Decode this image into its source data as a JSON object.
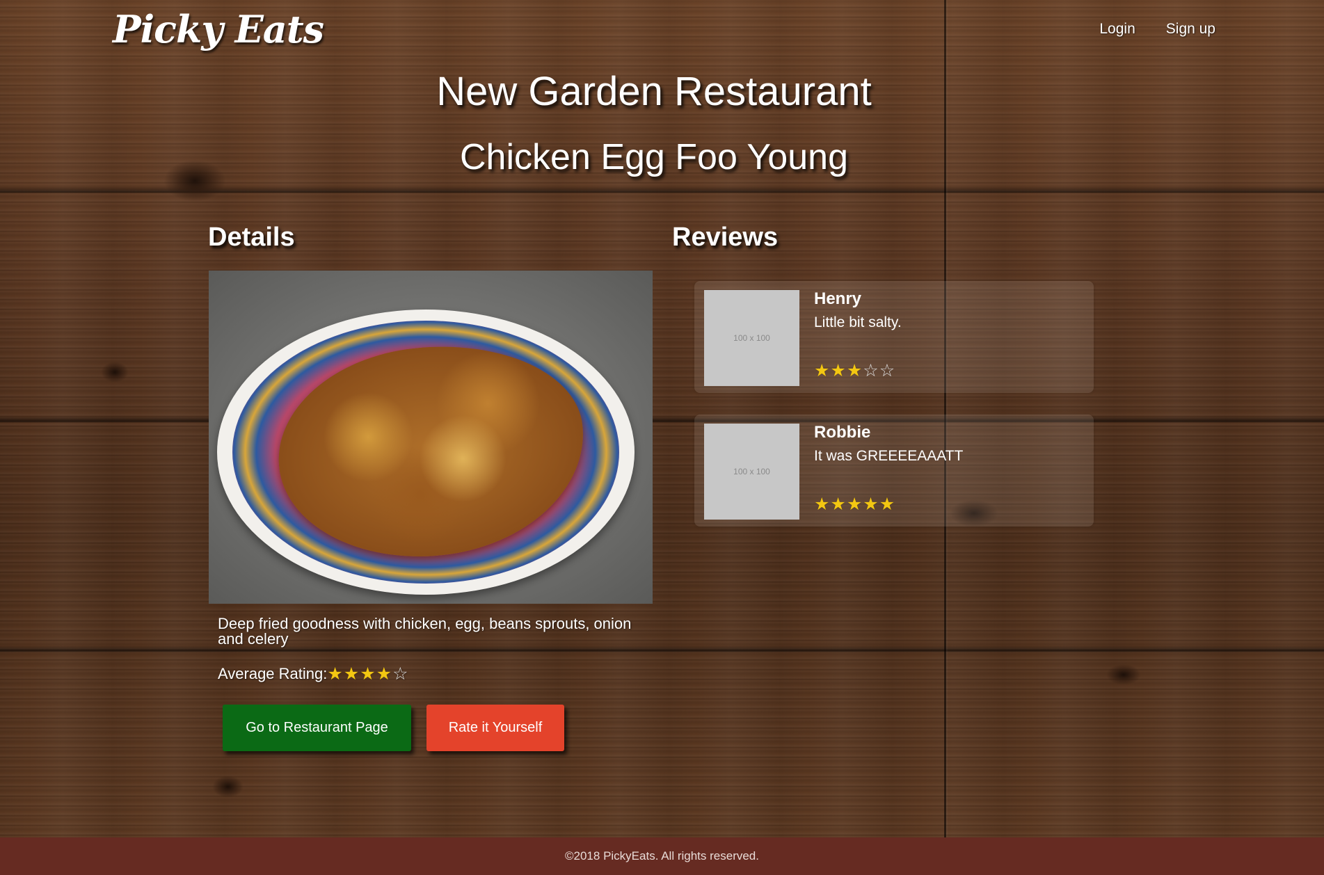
{
  "header": {
    "logo": "Picky Eats",
    "nav": {
      "login": "Login",
      "signup": "Sign up"
    }
  },
  "page": {
    "restaurant_name": "New Garden Restaurant",
    "dish_name": "Chicken Egg Foo Young"
  },
  "details": {
    "heading": "Details",
    "description": "Deep fried goodness with chicken, egg, beans sprouts, onion and celery",
    "average_rating_label": "Average Rating:",
    "average_rating": 4,
    "max_rating": 5,
    "restaurant_button": "Go to Restaurant Page",
    "rate_button": "Rate it Yourself"
  },
  "reviews": {
    "heading": "Reviews",
    "items": [
      {
        "avatar_placeholder": "100 x 100",
        "name": "Henry",
        "text": "Little bit salty.",
        "rating": 3
      },
      {
        "avatar_placeholder": "100 x 100",
        "name": "Robbie",
        "text": "It was GREEEEAAATT",
        "rating": 5
      }
    ]
  },
  "footer": {
    "copyright": "©2018 PickyEats. All rights reserved."
  },
  "colors": {
    "green_button": "#0b6a15",
    "red_button": "#e4432b",
    "footer_bg": "#662b22",
    "star_filled": "#f3c712"
  },
  "icons": {
    "star_filled": "star-filled-icon",
    "star_empty": "star-empty-icon"
  }
}
